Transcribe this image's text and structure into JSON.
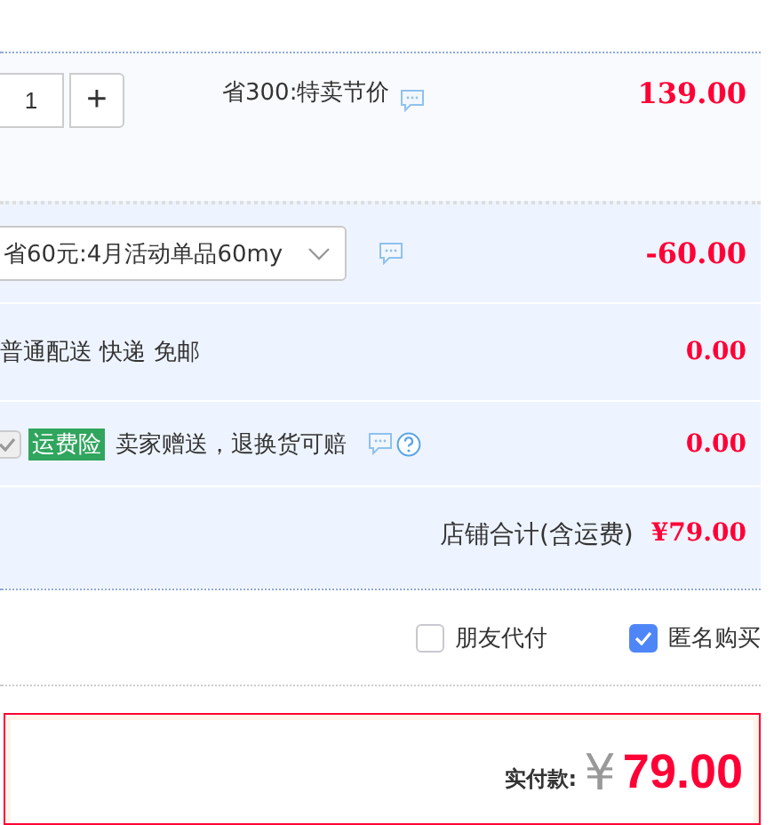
{
  "item": {
    "quantity": "1",
    "plus": "+",
    "promo": "省300:特卖节价",
    "price": "139.00"
  },
  "discount": {
    "value": "省60元:4月活动单品60my",
    "amount": "-60.00"
  },
  "shipping": {
    "text": "普通配送 快递 免邮",
    "amount": "0.00"
  },
  "insurance": {
    "checked": true,
    "disabled": true,
    "tag": "运费险",
    "text": "卖家赠送，退换货可赔",
    "amount": "0.00"
  },
  "subtotal": {
    "label": "店铺合计(含运费)",
    "amount": "¥79.00"
  },
  "options": [
    {
      "label": "朋友代付",
      "checked": false
    },
    {
      "label": "匿名购买",
      "checked": true
    }
  ],
  "payment": {
    "label": "实付款:",
    "currency": "¥",
    "amount": "79.00"
  }
}
